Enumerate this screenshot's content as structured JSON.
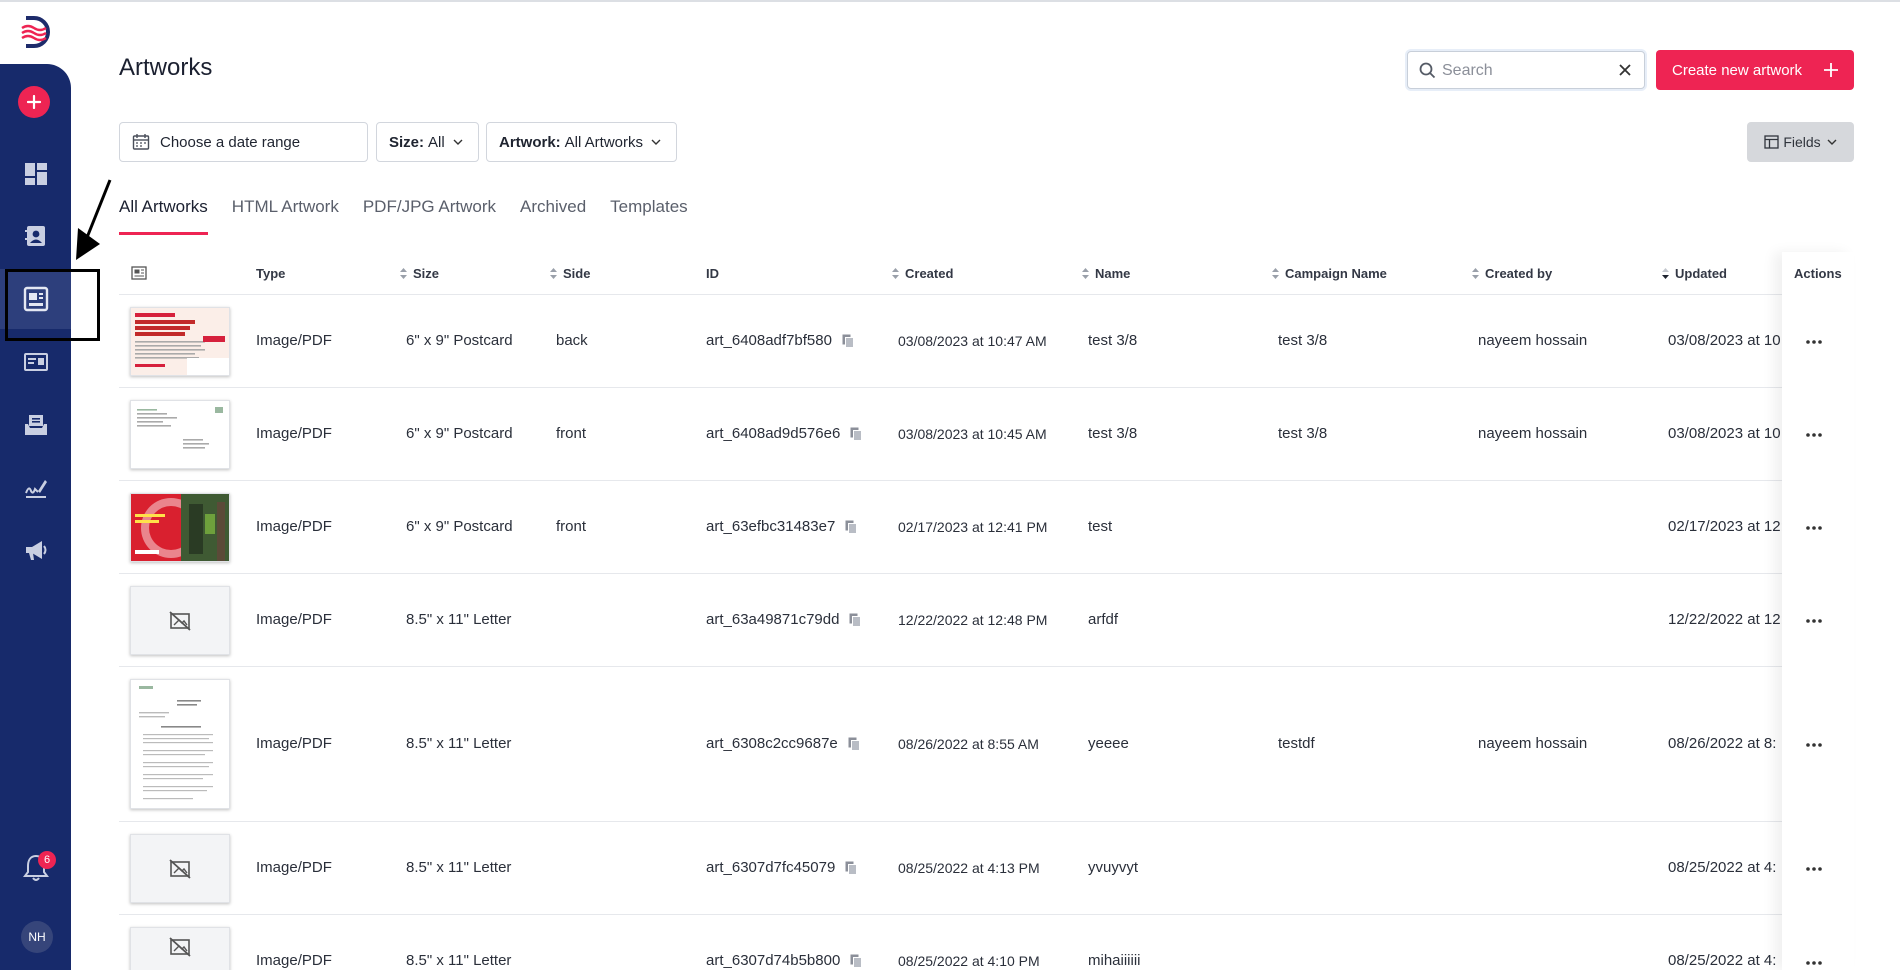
{
  "page": {
    "title": "Artworks"
  },
  "search": {
    "placeholder": "Search"
  },
  "header": {
    "create_label": "Create new artwork"
  },
  "filters": {
    "date_label": "Choose a date range",
    "size_key": "Size:",
    "size_value": "All",
    "artwork_key": "Artwork:",
    "artwork_value": "All Artworks",
    "fields_label": "Fields"
  },
  "tabs": [
    {
      "label": "All Artworks",
      "active": true
    },
    {
      "label": "HTML Artwork",
      "active": false
    },
    {
      "label": "PDF/JPG Artwork",
      "active": false
    },
    {
      "label": "Archived",
      "active": false
    },
    {
      "label": "Templates",
      "active": false
    }
  ],
  "table": {
    "columns": {
      "type": "Type",
      "size": "Size",
      "side": "Side",
      "id": "ID",
      "created": "Created",
      "name": "Name",
      "campaign": "Campaign Name",
      "created_by": "Created by",
      "updated": "Updated",
      "actions": "Actions"
    },
    "rows": [
      {
        "type": "Image/PDF",
        "size": "6\" x 9\" Postcard",
        "side": "back",
        "id": "art_6408adf7bf580",
        "created": "03/08/2023 at 10:47 AM",
        "name": "test 3/8",
        "campaign": "test 3/8",
        "created_by": "nayeem hossain",
        "updated": "03/08/2023 at 10",
        "thumb": "congrats"
      },
      {
        "type": "Image/PDF",
        "size": "6\" x 9\" Postcard",
        "side": "front",
        "id": "art_6408ad9d576e6",
        "created": "03/08/2023 at 10:45 AM",
        "name": "test 3/8",
        "campaign": "test 3/8",
        "created_by": "nayeem hossain",
        "updated": "03/08/2023 at 10",
        "thumb": "letter-small"
      },
      {
        "type": "Image/PDF",
        "size": "6\" x 9\" Postcard",
        "side": "front",
        "id": "art_63efbc31483e7",
        "created": "02/17/2023 at 12:41 PM",
        "name": "test",
        "campaign": "",
        "created_by": "",
        "updated": "02/17/2023 at 12:",
        "thumb": "red-photo"
      },
      {
        "type": "Image/PDF",
        "size": "8.5\" x 11\" Letter",
        "side": "",
        "id": "art_63a49871c79dd",
        "created": "12/22/2022 at 12:48 PM",
        "name": "arfdf",
        "campaign": "",
        "created_by": "",
        "updated": "12/22/2022 at 12:",
        "thumb": "placeholder"
      },
      {
        "type": "Image/PDF",
        "size": "8.5\" x 11\" Letter",
        "side": "",
        "id": "art_6308c2cc9687e",
        "created": "08/26/2022 at 8:55 AM",
        "name": "yeeee",
        "campaign": "testdf",
        "created_by": "nayeem hossain",
        "updated": "08/26/2022 at 8:",
        "thumb": "document"
      },
      {
        "type": "Image/PDF",
        "size": "8.5\" x 11\" Letter",
        "side": "",
        "id": "art_6307d7fc45079",
        "created": "08/25/2022 at 4:13 PM",
        "name": "yvuyvyt",
        "campaign": "",
        "created_by": "",
        "updated": "08/25/2022 at 4:",
        "thumb": "placeholder"
      },
      {
        "type": "Image/PDF",
        "size": "8.5\" x 11\" Letter",
        "side": "",
        "id": "art_6307d74b5b800",
        "created": "08/25/2022 at 4:10 PM",
        "name": "mihaiiiiii",
        "campaign": "",
        "created_by": "",
        "updated": "08/25/2022 at 4:",
        "thumb": "placeholder"
      }
    ]
  },
  "notifications": {
    "count": "6"
  },
  "user": {
    "initials": "NH"
  },
  "colors": {
    "sidebar": "#172a6b",
    "accent": "#ee2453"
  },
  "icons": [
    "logo-icon",
    "plus-icon",
    "dashboard-icon",
    "contacts-icon",
    "artworks-icon",
    "cards-icon",
    "mailbox-icon",
    "signature-icon",
    "megaphone-icon",
    "bell-icon",
    "search-icon",
    "clear-icon",
    "calendar-icon",
    "chevron-down-icon",
    "fields-icon",
    "copy-icon",
    "more-icon",
    "sort-icon",
    "no-image-icon"
  ]
}
